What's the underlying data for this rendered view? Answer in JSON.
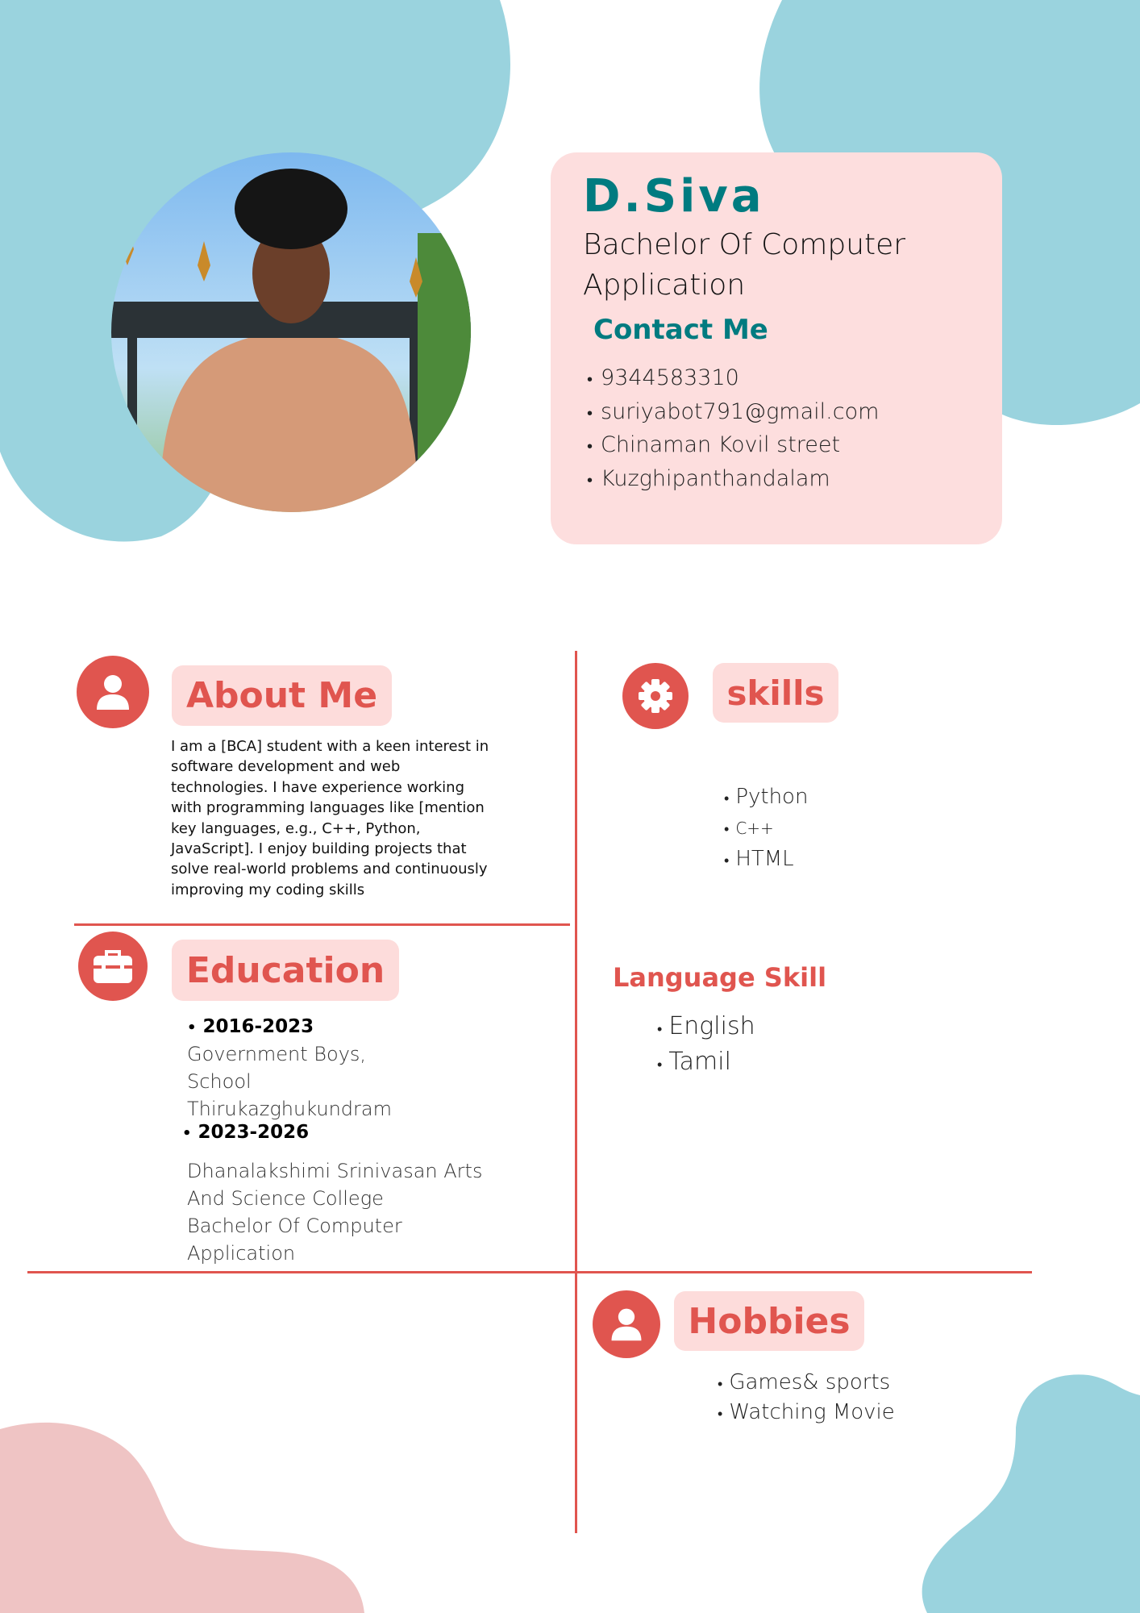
{
  "colors": {
    "blob_blue": "#9ad3de",
    "blob_pink": "#efc4c4",
    "card": "#fddede",
    "teal": "#007b80",
    "accent": "#e0554f",
    "pill": "#fddcdb"
  },
  "header": {
    "name": "D.Siva",
    "degree": "Bachelor Of Computer Application",
    "contact_heading": "Contact Me",
    "contacts": [
      "9344583310",
      "suriyabot791@gmail.com",
      "Chinaman Kovil street",
      "Kuzghipanthandalam"
    ]
  },
  "about": {
    "icon": "user-icon",
    "title": "About Me",
    "text": "I am a [BCA] student with a keen interest in software development and web technologies. I have experience working with programming languages like [mention key languages, e.g., C++, Python, JavaScript]. I enjoy building projects that solve real-world problems and continuously improving my coding skills"
  },
  "skills": {
    "icon": "gear-icon",
    "title": "skills",
    "items": [
      "Python",
      "C++",
      "HTML"
    ]
  },
  "language": {
    "title": "Language Skill",
    "items": [
      "English",
      "Tamil"
    ]
  },
  "education": {
    "icon": "briefcase-icon",
    "title": "Education",
    "entries": [
      {
        "years": "2016-2023",
        "lines": [
          "Government Boys,",
          "School",
          "Thirukazghukundram"
        ]
      },
      {
        "years": "2023-2026",
        "lines": [
          "Dhanalakshimi Srinivasan Arts",
          "And Science College",
          "Bachelor Of Computer",
          "Application"
        ]
      }
    ]
  },
  "hobbies": {
    "icon": "user-icon",
    "title": "Hobbies",
    "items": [
      "Games& sports",
      "Watching Movie"
    ]
  }
}
